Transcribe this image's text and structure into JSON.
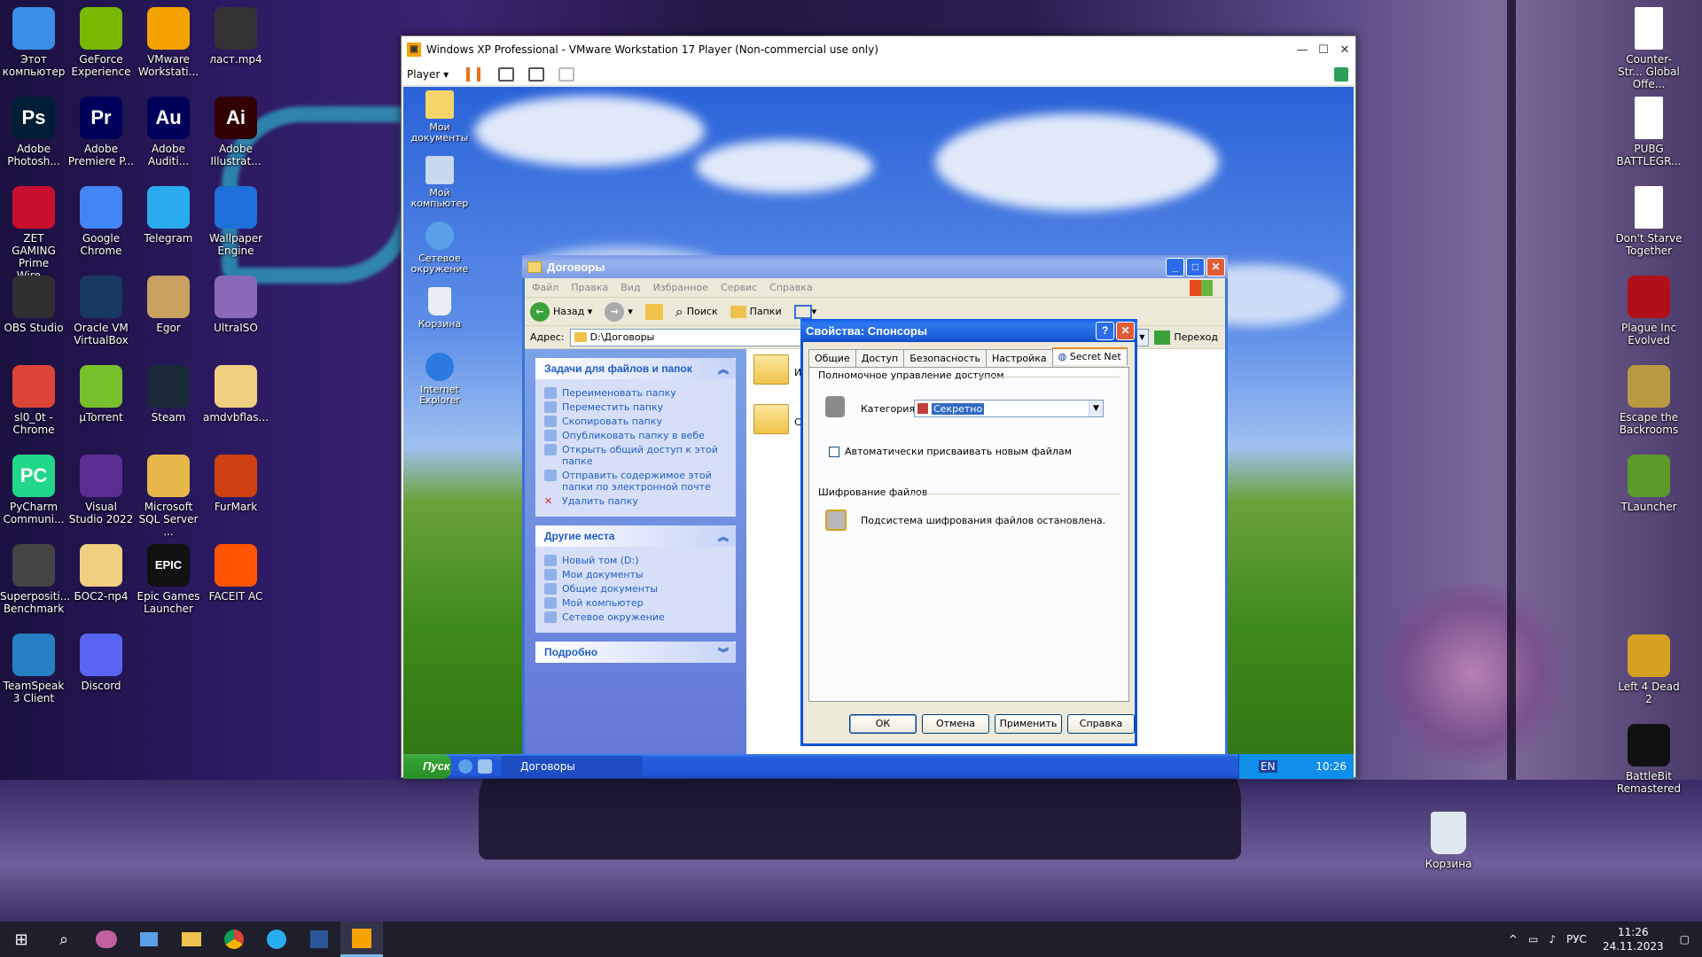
{
  "desktop": {
    "left_icons": [
      {
        "label": "Этот компьютер",
        "icon": "computer-icon",
        "color": "#3a8ee6"
      },
      {
        "label": "GeForce Experience",
        "icon": "nvidia-icon",
        "color": "#76b900"
      },
      {
        "label": "VMware Workstati...",
        "icon": "vmware-icon",
        "color": "#f4a300"
      },
      {
        "label": "ласт.mp4",
        "icon": "video-file-icon",
        "color": "#333333"
      },
      {
        "label": "Adobe Photosh...",
        "icon": "photoshop-icon",
        "color": "#001e36",
        "glyph": "Ps"
      },
      {
        "label": "Adobe Premiere P...",
        "icon": "premiere-icon",
        "color": "#00005b",
        "glyph": "Pr"
      },
      {
        "label": "Adobe Auditi...",
        "icon": "audition-icon",
        "color": "#00005b",
        "glyph": "Au"
      },
      {
        "label": "Adobe Illustrat...",
        "icon": "illustrator-icon",
        "color": "#330000",
        "glyph": "Ai"
      },
      {
        "label": "ZET GAMING Prime Wire...",
        "icon": "zet-gaming-icon",
        "color": "#c8102e"
      },
      {
        "label": "Google Chrome",
        "icon": "chrome-icon",
        "color": "#4285f4"
      },
      {
        "label": "Telegram",
        "icon": "telegram-icon",
        "color": "#2aabee"
      },
      {
        "label": "Wallpaper Engine",
        "icon": "wallpaper-engine-icon",
        "color": "#1e6fd9"
      },
      {
        "label": "OBS Studio",
        "icon": "obs-icon",
        "color": "#302e31"
      },
      {
        "label": "Oracle VM VirtualBox",
        "icon": "virtualbox-icon",
        "color": "#183a61"
      },
      {
        "label": "Egor",
        "icon": "folder-icon",
        "color": "#c8a060"
      },
      {
        "label": "UltraISO",
        "icon": "ultraiso-icon",
        "color": "#8a6ab8"
      },
      {
        "label": "sl0_0t - Chrome",
        "icon": "chrome-profile-icon",
        "color": "#db4437"
      },
      {
        "label": "µTorrent",
        "icon": "utorrent-icon",
        "color": "#78c02b"
      },
      {
        "label": "Steam",
        "icon": "steam-icon",
        "color": "#1b2838"
      },
      {
        "label": "amdvbflas...",
        "icon": "folder-zip-icon",
        "color": "#f0d080"
      },
      {
        "label": "PyCharm Communi...",
        "icon": "pycharm-icon",
        "color": "#21d789",
        "glyph": "PC"
      },
      {
        "label": "Visual Studio 2022",
        "icon": "visual-studio-icon",
        "color": "#5c2d91"
      },
      {
        "label": "Microsoft SQL Server ...",
        "icon": "sql-server-icon",
        "color": "#e8b84a"
      },
      {
        "label": "FurMark",
        "icon": "furmark-icon",
        "color": "#d04010"
      },
      {
        "label": "Superpositi... Benchmark",
        "icon": "superposition-icon",
        "color": "#444444"
      },
      {
        "label": "БОС2-пр4",
        "icon": "folder-zip-icon",
        "color": "#f0d080"
      },
      {
        "label": "Epic Games Launcher",
        "icon": "epic-games-icon",
        "color": "#111111",
        "glyph": "EPIC"
      },
      {
        "label": "FACEIT AC",
        "icon": "faceit-icon",
        "color": "#ff5500"
      },
      {
        "label": "TeamSpeak 3 Client",
        "icon": "teamspeak-icon",
        "color": "#2580c3"
      },
      {
        "label": "Discord",
        "icon": "discord-icon",
        "color": "#5865f2"
      }
    ],
    "right_icons": [
      {
        "label": "Counter-Str... Global Offe...",
        "icon": "file-icon",
        "color": "#ffffff"
      },
      {
        "label": "PUBG BATTLEGR...",
        "icon": "file-icon",
        "color": "#ffffff"
      },
      {
        "label": "Don't Starve Together",
        "icon": "file-icon",
        "color": "#ffffff"
      },
      {
        "label": "Plague Inc Evolved",
        "icon": "plague-inc-icon",
        "color": "#b0101a"
      },
      {
        "label": "Escape the Backrooms",
        "icon": "backrooms-icon",
        "color": "#b89a40"
      },
      {
        "label": "TLauncher",
        "icon": "tlauncher-icon",
        "color": "#5c9a2c"
      },
      {
        "label": "Left 4 Dead 2",
        "icon": "left4dead-icon",
        "color": "#d8a020"
      },
      {
        "label": "BattleBit Remastered",
        "icon": "battlebit-icon",
        "color": "#111111"
      }
    ],
    "recycle_bin": "Корзина"
  },
  "taskbar": {
    "items": [
      "start-icon",
      "search-icon",
      "app-icon",
      "explorer-window-icon",
      "folder-icon",
      "chrome-icon",
      "telegram-icon",
      "word-icon",
      "vmware-icon"
    ],
    "language": "РУС",
    "time": "11:26",
    "date": "24.11.2023"
  },
  "vmware": {
    "title": "Windows XP Professional - VMware Workstation 17 Player (Non-commercial use only)",
    "player_menu": "Player ▾"
  },
  "xp": {
    "desktop_icons": [
      "Мои документы",
      "Мой компьютер",
      "Сетевое окружение",
      "Корзина",
      "Internet Explorer"
    ],
    "explorer": {
      "title": "Договоры",
      "menu": [
        "Файл",
        "Правка",
        "Вид",
        "Избранное",
        "Сервис",
        "Справка"
      ],
      "toolbar": {
        "back": "Назад",
        "search": "Поиск",
        "folders": "Папки"
      },
      "address_label": "Адрес:",
      "address": "D:\\Договоры",
      "go": "Переход",
      "tasks": {
        "title": "Задачи для файлов и папок",
        "items": [
          "Переименовать папку",
          "Переместить папку",
          "Скопировать папку",
          "Опубликовать папку в вебе",
          "Открыть общий доступ к этой папке",
          "Отправить содержимое этой папки по электронной почте",
          "Удалить папку"
        ]
      },
      "places": {
        "title": "Другие места",
        "items": [
          "Новый том (D:)",
          "Мои документы",
          "Общие документы",
          "Мой компьютер",
          "Сетевое окружение"
        ]
      },
      "details": {
        "title": "Подробно"
      },
      "folders": [
        "Ин",
        "Сп"
      ]
    },
    "dialog": {
      "title": "Свойства: Спонсоры",
      "tabs": [
        "Общие",
        "Доступ",
        "Безопасность",
        "Настройка",
        "Secret Net"
      ],
      "group1": "Полномочное управление доступом",
      "category_label": "Категория",
      "category_value": "Секретно",
      "checkbox": "Автоматически присваивать новым файлам",
      "group2": "Шифрование файлов",
      "encryption_status": "Подсистема шифрования файлов остановлена.",
      "buttons": {
        "ok": "ОК",
        "cancel": "Отмена",
        "apply": "Применить",
        "help": "Справка"
      }
    },
    "taskbar": {
      "start": "Пуск",
      "task": "Договоры",
      "lang": "EN",
      "time": "10:26"
    }
  }
}
